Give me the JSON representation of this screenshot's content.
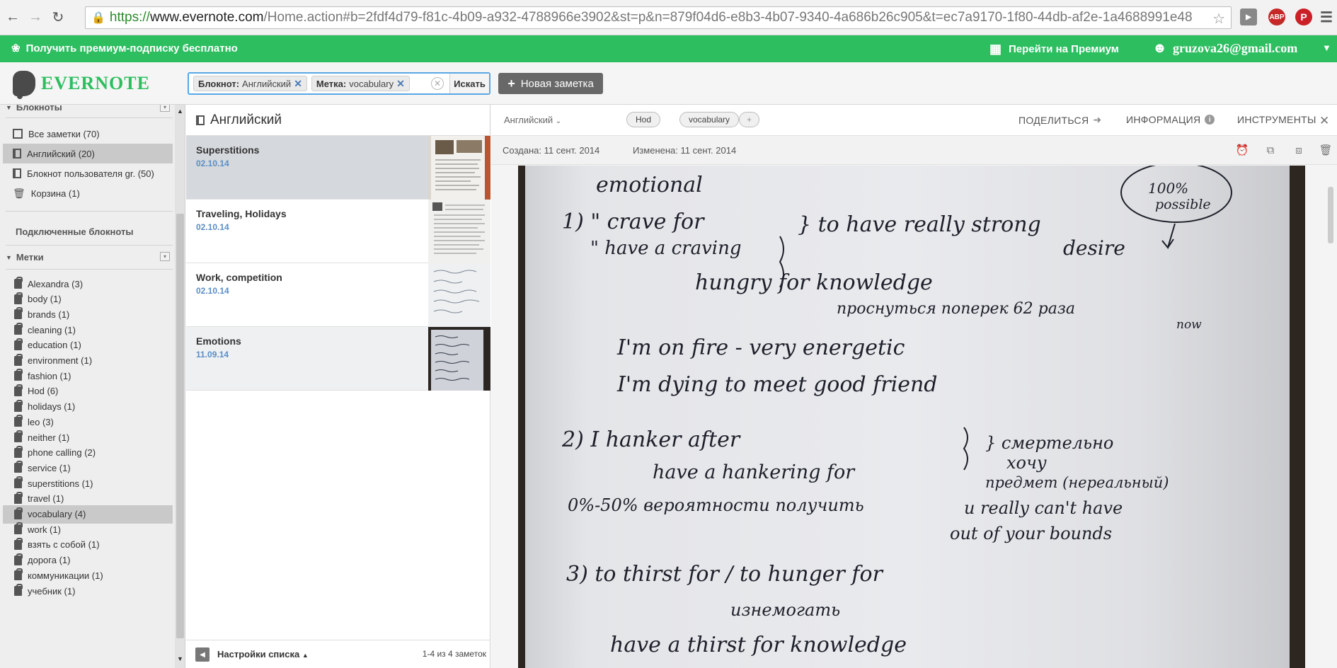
{
  "browser": {
    "url_scheme": "https://",
    "url_host": "www.evernote.com",
    "url_path": "/Home.action#b=2fdf4d79-f81c-4b09-a932-4788966e3902&st=p&n=879f04d6-e8b3-4b07-9340-4a686b26c905&t=ec7a9170-1f80-44db-af2e-1a4688991e48",
    "ext_abp": "ABP"
  },
  "promo": {
    "get_premium": "Получить премиум-подписку бесплатно",
    "go_premium": "Перейти на Премиум",
    "user_email": "gruzova26@gmail.com"
  },
  "header": {
    "logo_text": "EVERNOTE",
    "search": {
      "chip_notebook_label": "Блокнот:",
      "chip_notebook_value": "Английский",
      "chip_tag_label": "Метка:",
      "chip_tag_value": "vocabulary",
      "search_button": "Искать"
    },
    "new_note": "Новая заметка"
  },
  "sidebar": {
    "notebooks_header": "Блокноты",
    "notebooks": [
      {
        "label": "Все заметки (70)"
      },
      {
        "label": "Английский (20)"
      },
      {
        "label": "Блокнот пользователя gr. (50)"
      },
      {
        "label": "Корзина (1)"
      }
    ],
    "linked_header": "Подключенные блокноты",
    "tags_header": "Метки",
    "tags": [
      {
        "label": "Alexandra (3)"
      },
      {
        "label": "body (1)"
      },
      {
        "label": "brands (1)"
      },
      {
        "label": "cleaning (1)"
      },
      {
        "label": "education (1)"
      },
      {
        "label": "environment (1)"
      },
      {
        "label": "fashion (1)"
      },
      {
        "label": "Hod (6)"
      },
      {
        "label": "holidays (1)"
      },
      {
        "label": "leo (3)"
      },
      {
        "label": "neither (1)"
      },
      {
        "label": "phone calling (2)"
      },
      {
        "label": "service (1)"
      },
      {
        "label": "superstitions (1)"
      },
      {
        "label": "travel (1)"
      },
      {
        "label": "vocabulary (4)"
      },
      {
        "label": "work (1)"
      },
      {
        "label": "взять с собой (1)"
      },
      {
        "label": "дорога (1)"
      },
      {
        "label": "коммуникации (1)"
      },
      {
        "label": "учебник (1)"
      }
    ]
  },
  "notelist": {
    "title": "Английский",
    "notes": [
      {
        "title": "Superstitions",
        "date": "02.10.14"
      },
      {
        "title": "Traveling, Holidays",
        "date": "02.10.14"
      },
      {
        "title": "Work, competition",
        "date": "02.10.14"
      },
      {
        "title": "Emotions",
        "date": "11.09.14"
      }
    ],
    "footer_label": "Настройки списка",
    "footer_count": "1-4 из 4 заметок"
  },
  "editor": {
    "notebook": "Английский",
    "tags": [
      "Hod",
      "vocabulary"
    ],
    "add_tag": "+",
    "share": "ПОДЕЛИТЬСЯ",
    "info": "ИНФОРМАЦИЯ",
    "tools": "ИНСТРУМЕНТЫ",
    "created": "Создана: 11 сент. 2014",
    "modified": "Изменена: 11 сент. 2014",
    "handwriting": [
      "emotional",
      "1) \" crave for",
      "\" have a craving",
      "} to have really strong",
      "desire",
      "100%",
      "possible",
      "hungry for knowledge",
      "проснуться поперек 62 раза",
      "now",
      "I'm on fire - very energetic",
      "I'm dying to meet good friend",
      "2) I hanker after",
      "have a hankering for",
      "} смертельно",
      "хочу",
      "предмет (нереальный)",
      "0%-50% вероятности получить",
      "u really can't have",
      "out of your bounds",
      "3) to thirst for / to hunger for",
      "изнемогать",
      "have a thirst for knowledge"
    ]
  }
}
